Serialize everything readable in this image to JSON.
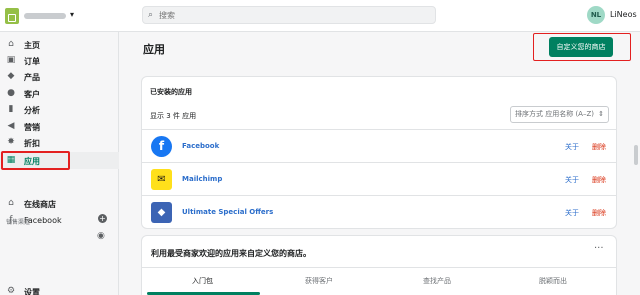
{
  "header": {
    "search_placeholder": "搜索",
    "avatar_initials": "NL",
    "username": "LiNeos"
  },
  "sidebar": {
    "items": [
      {
        "label": "主页",
        "icon": "home-icon"
      },
      {
        "label": "订单",
        "icon": "orders-icon"
      },
      {
        "label": "产品",
        "icon": "tag-icon"
      },
      {
        "label": "客户",
        "icon": "person-icon"
      },
      {
        "label": "分析",
        "icon": "bar-chart-icon"
      },
      {
        "label": "营销",
        "icon": "megaphone-icon"
      },
      {
        "label": "折扣",
        "icon": "discount-icon"
      },
      {
        "label": "应用",
        "icon": "apps-icon"
      }
    ],
    "channels_label": "销售渠道",
    "channels": [
      {
        "label": "在线商店",
        "icon": "store-icon"
      },
      {
        "label": "Facebook",
        "icon": "facebook-icon"
      }
    ],
    "settings_label": "设置"
  },
  "page": {
    "title": "应用",
    "primary_button": "自定义您的商店"
  },
  "installed": {
    "title": "已安装的应用",
    "count_text": "显示 3 件 应用",
    "sort_label": "排序方式 应用名称 (A–Z)",
    "apps": [
      {
        "name": "Facebook",
        "about": "关于",
        "delete": "删除",
        "color": "#1877f2"
      },
      {
        "name": "Mailchimp",
        "about": "关于",
        "delete": "删除",
        "color": "#ffe01b"
      },
      {
        "name": "Ultimate Special Offers",
        "about": "关于",
        "delete": "删除",
        "color": "#3c64b4"
      }
    ]
  },
  "recommend": {
    "title": "利用最受商家欢迎的应用来自定义您的商店。",
    "tabs": [
      "入门包",
      "获得客户",
      "查找产品",
      "脱颖而出"
    ]
  },
  "colors": {
    "accent": "#008060",
    "link": "#2c6ecb",
    "danger": "#d82c0d"
  }
}
